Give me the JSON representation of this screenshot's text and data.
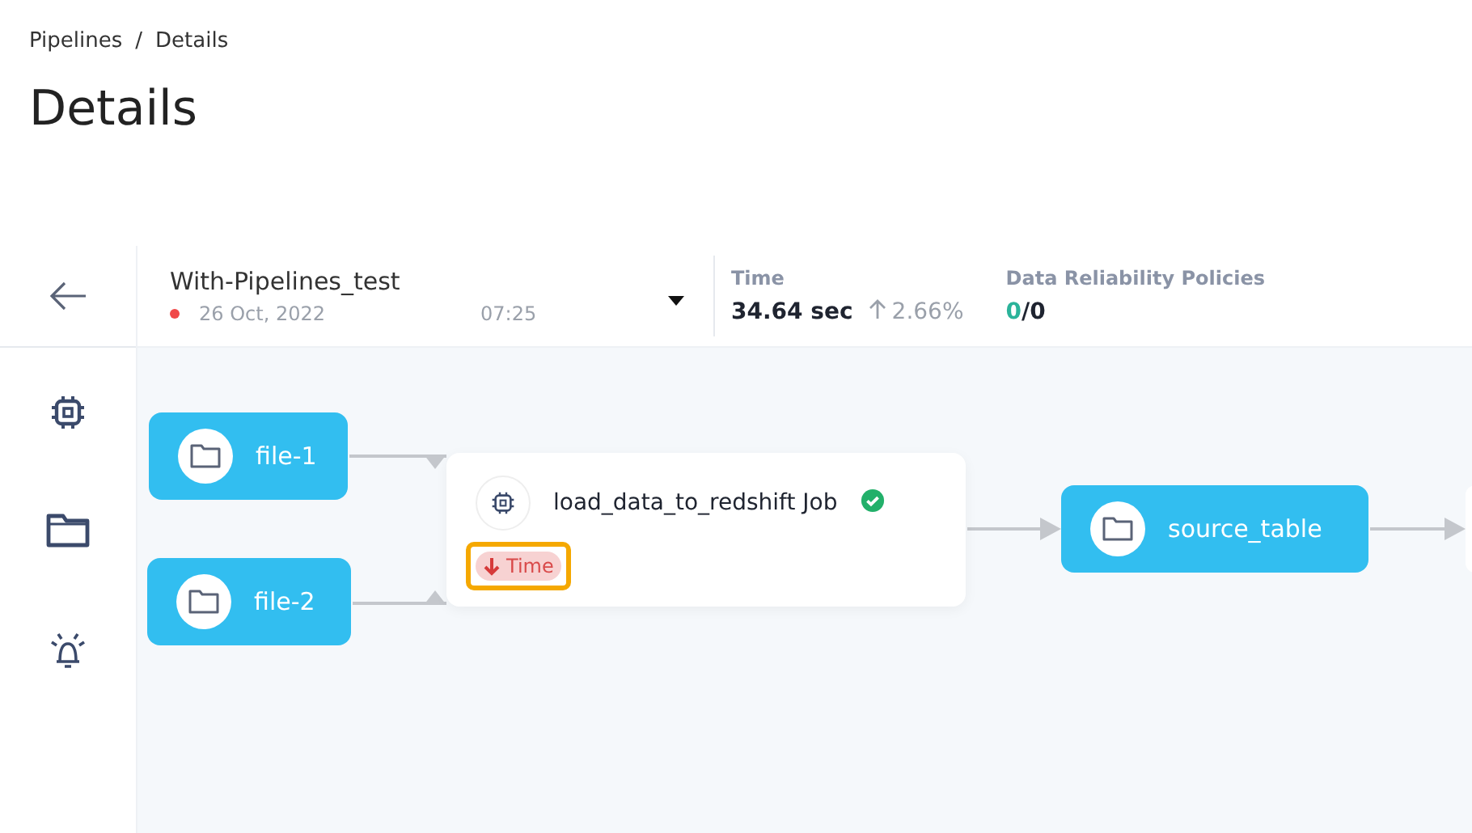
{
  "breadcrumb": {
    "items": [
      "Pipelines",
      "Details"
    ],
    "separator": "/"
  },
  "title": "Details",
  "pipeline": {
    "name": "With-Pipelines_test",
    "failed": true,
    "date": "26 Oct, 2022",
    "time": "07:25"
  },
  "metrics": [
    {
      "label": "Time",
      "value": "34.64 sec",
      "change": "2.66%",
      "kind": "change"
    },
    {
      "label": "Data Reliability Policies",
      "passed": "0",
      "separator": "/",
      "total": "0",
      "kind": "ratio"
    }
  ],
  "sidebar": {
    "items": [
      {
        "kind": "chip"
      },
      {
        "kind": "folder"
      },
      {
        "kind": "alarm"
      }
    ]
  },
  "nodes": [
    {
      "kind": "file",
      "label": "file-1"
    },
    {
      "kind": "file",
      "label": "file-2"
    },
    {
      "kind": "job",
      "label": "load_data_to_redshift Job",
      "success": true,
      "tags": [
        {
          "label": "Time",
          "highlighted": true
        }
      ]
    },
    {
      "kind": "file",
      "label": "source_table"
    },
    {
      "kind": "hidden"
    }
  ]
}
